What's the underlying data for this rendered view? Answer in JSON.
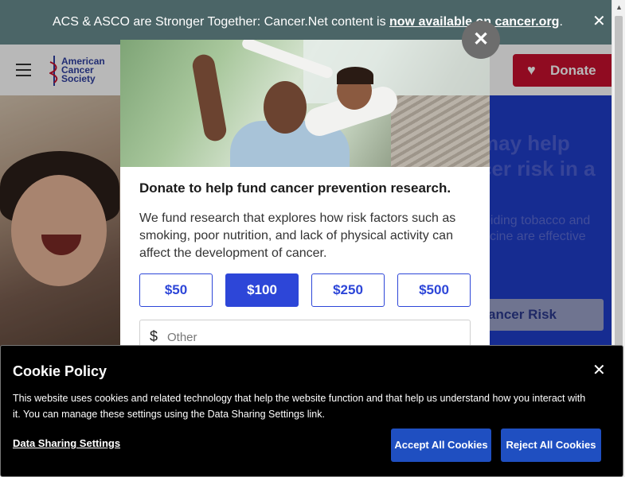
{
  "announcement": {
    "text_before": "ACS & ASCO are Stronger Together: Cancer.Net content is ",
    "link_text": "now available on cancer.org",
    "text_after": ".",
    "close_symbol": "✕"
  },
  "header": {
    "logo_lines": [
      "American",
      "Cancer",
      "Society"
    ],
    "donate_label": "Donate",
    "donate_color": "#c8102e"
  },
  "hero": {
    "headline_lines": [
      "may help",
      "cer risk in a"
    ],
    "paragraph_lines": [
      "oiding tobacco and",
      "ccine are effective"
    ],
    "button_label": "ancer Risk",
    "background_color": "#1f3ec9"
  },
  "modal": {
    "close_symbol": "✕",
    "title": "Donate to help fund cancer prevention research.",
    "body": "We fund research that explores how risk factors such as smoking, poor nutrition, and lack of physical activity can affect the development of cancer.",
    "amounts": [
      {
        "label": "$50",
        "selected": false
      },
      {
        "label": "$100",
        "selected": true
      },
      {
        "label": "$250",
        "selected": false
      },
      {
        "label": "$500",
        "selected": false
      }
    ],
    "other": {
      "currency_symbol": "$",
      "placeholder": "Other",
      "value": ""
    },
    "accent_color": "#2d46d8"
  },
  "cookie_banner": {
    "title": "Cookie Policy",
    "close_symbol": "✕",
    "text": "This website uses cookies and related technology that help the website function and that help us understand how you interact with it. You can manage these settings using the Data Sharing Settings link.",
    "settings_link": "Data Sharing Settings",
    "accept_label": "Accept All Cookies",
    "reject_label": "Reject All Cookies",
    "button_color": "#1f4fc1"
  }
}
